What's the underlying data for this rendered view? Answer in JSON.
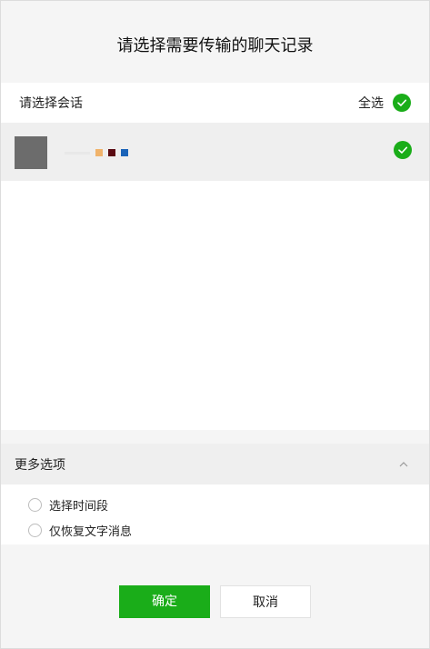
{
  "dialog": {
    "title": "请选择需要传输的聊天记录"
  },
  "conversation_section": {
    "header_label": "请选择会话",
    "select_all_label": "全选",
    "select_all_checked": true
  },
  "conversations": [
    {
      "name_masked": true,
      "checked": true,
      "avatar_color": "#6c6c6c",
      "name_color_marks": [
        "#f0b36b",
        "#5a0a12",
        "#1a63b8"
      ]
    }
  ],
  "more_options": {
    "header_label": "更多选项",
    "expanded": true,
    "chevron_icon": "chevron-up-icon",
    "items": [
      {
        "label": "选择时间段",
        "selected": false
      },
      {
        "label": "仅恢复文字消息",
        "selected": false
      }
    ]
  },
  "buttons": {
    "confirm_label": "确定",
    "cancel_label": "取消"
  },
  "colors": {
    "accent": "#1aad19",
    "selected_row_bg": "#efefef",
    "window_bg": "#f5f5f5"
  }
}
